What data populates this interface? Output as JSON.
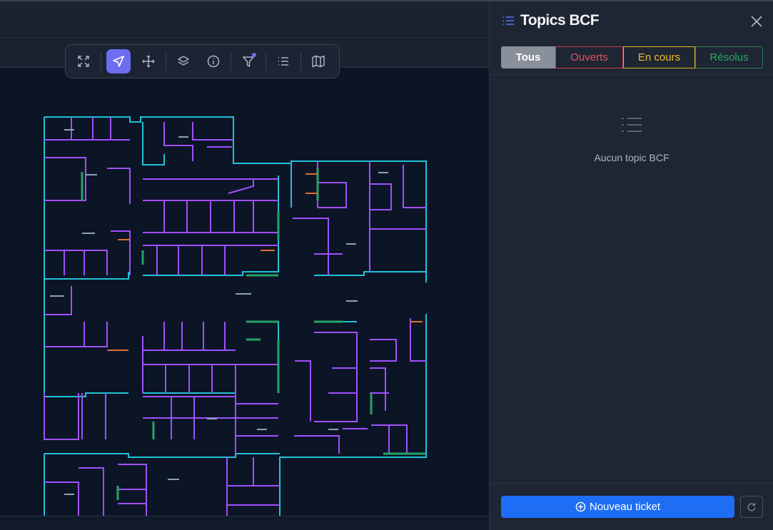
{
  "toolbar": {
    "tools": [
      {
        "name": "fullscreen",
        "icon": "expand-icon"
      },
      {
        "name": "select",
        "icon": "cursor-arrow-icon",
        "active": true
      },
      {
        "name": "pan",
        "icon": "move-arrows-icon"
      },
      {
        "name": "layers",
        "icon": "layers-icon"
      },
      {
        "name": "info",
        "icon": "info-icon"
      },
      {
        "name": "filter",
        "icon": "filter-icon",
        "badge": true
      },
      {
        "name": "list",
        "icon": "list-icon"
      },
      {
        "name": "map",
        "icon": "map-icon"
      }
    ],
    "accent": "#6d6df0"
  },
  "panel": {
    "title": "Topics BCF",
    "title_icon": "list-icon",
    "filters": {
      "all": "Tous",
      "open": "Ouverts",
      "in_progress": "En cours",
      "resolved": "Résolus"
    },
    "empty_text": "Aucun topic BCF",
    "new_ticket_label": "Nouveau ticket"
  },
  "colors": {
    "primary": "#1d6ef5",
    "open": "#e2525f",
    "in_progress": "#f0bd2f",
    "resolved": "#2aa860",
    "wall_cyan": "#22c1d6",
    "wall_purple": "#a050ff"
  }
}
